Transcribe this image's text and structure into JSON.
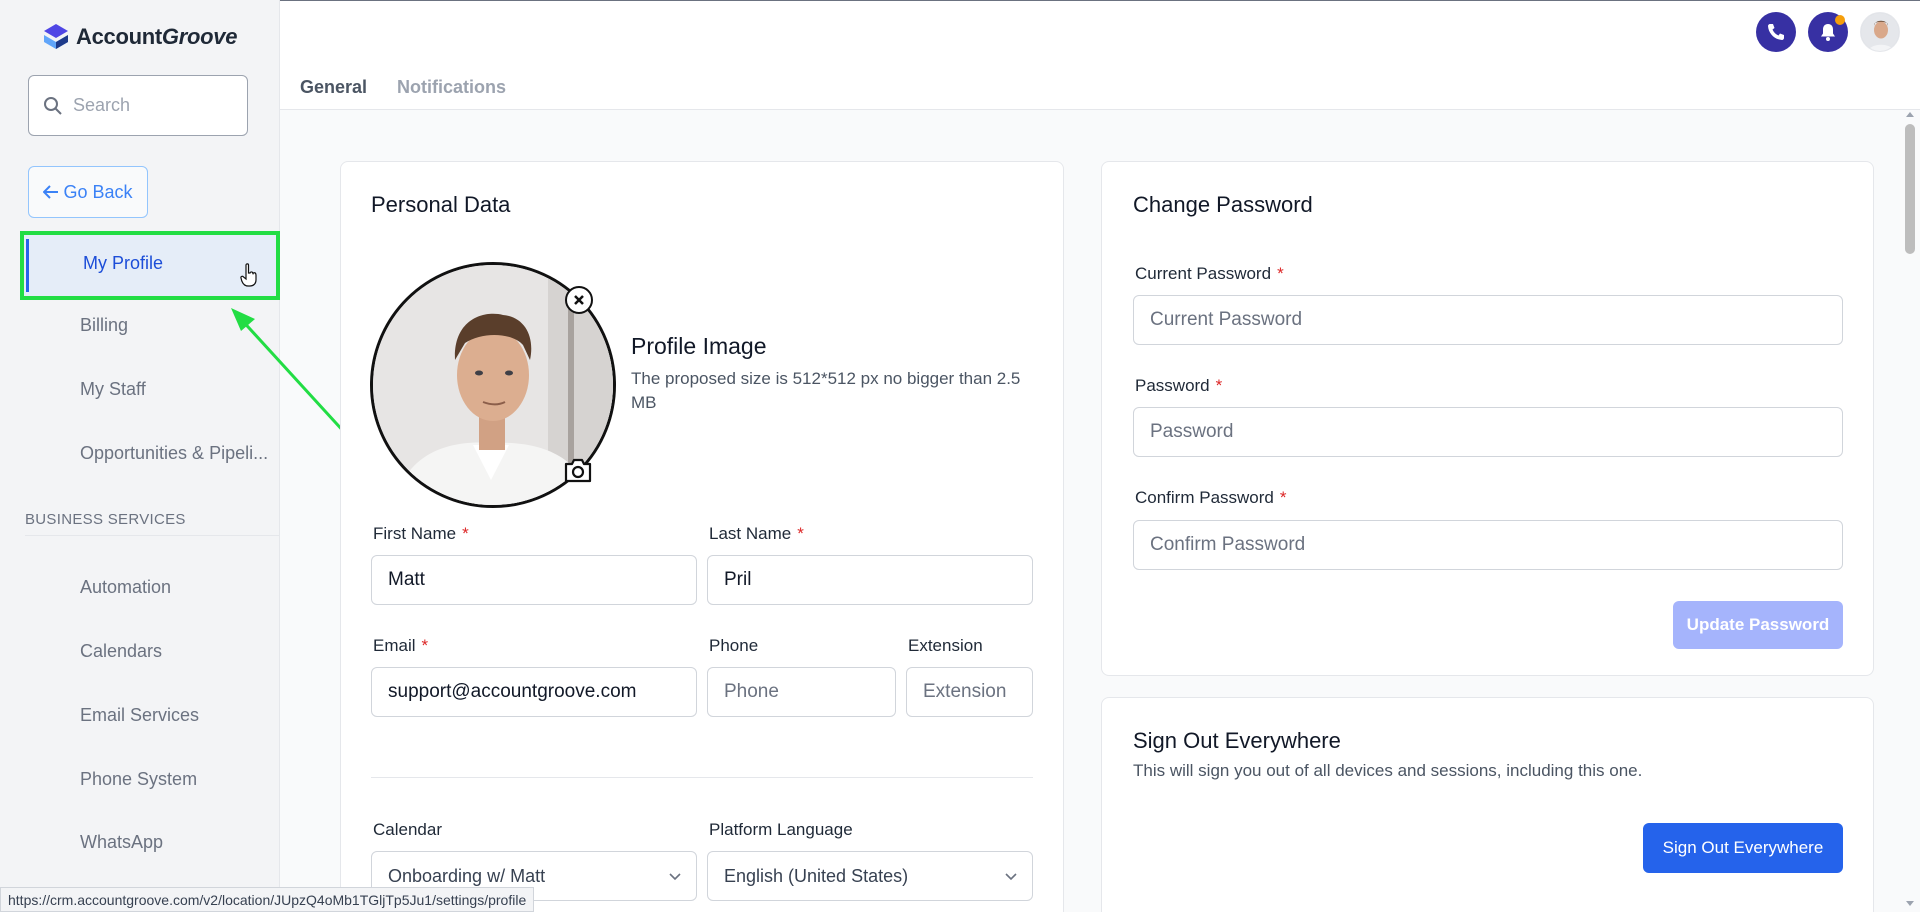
{
  "app": {
    "logo_text_main": "Account",
    "logo_text_accent": "Groove"
  },
  "sidebar": {
    "search_placeholder": "Search",
    "go_back_label": "Go Back",
    "items": [
      {
        "label": "My Profile",
        "active": true
      },
      {
        "label": "Billing"
      },
      {
        "label": "My Staff"
      },
      {
        "label": "Opportunities & Pipeli..."
      }
    ],
    "section_label": "BUSINESS SERVICES",
    "business_items": [
      {
        "label": "Automation"
      },
      {
        "label": "Calendars"
      },
      {
        "label": "Email Services"
      },
      {
        "label": "Phone System"
      },
      {
        "label": "WhatsApp"
      }
    ]
  },
  "tabs": [
    {
      "label": "General",
      "active": true
    },
    {
      "label": "Notifications"
    }
  ],
  "personal_data": {
    "title": "Personal Data",
    "profile_image_title": "Profile Image",
    "profile_image_hint": "The proposed size is 512*512 px no bigger than 2.5 MB",
    "first_name": {
      "label": "First Name",
      "value": "Matt",
      "required": true
    },
    "last_name": {
      "label": "Last Name",
      "value": "Pril",
      "required": true
    },
    "email": {
      "label": "Email",
      "value": "support@accountgroove.com",
      "required": true
    },
    "phone": {
      "label": "Phone",
      "placeholder": "Phone"
    },
    "extension": {
      "label": "Extension",
      "placeholder": "Extension"
    },
    "calendar": {
      "label": "Calendar",
      "value": "Onboarding w/ Matt"
    },
    "platform_language": {
      "label": "Platform Language",
      "value": "English (United States)"
    }
  },
  "change_password": {
    "title": "Change Password",
    "current_password": {
      "label": "Current Password",
      "placeholder": "Current Password",
      "required": true
    },
    "password": {
      "label": "Password",
      "placeholder": "Password",
      "required": true
    },
    "confirm_password": {
      "label": "Confirm Password",
      "placeholder": "Confirm Password",
      "required": true
    },
    "update_button": "Update Password"
  },
  "sign_out": {
    "title": "Sign Out Everywhere",
    "description": "This will sign you out of all devices and sessions, including this one.",
    "button": "Sign Out Everywhere"
  },
  "status_bar_url": "https://crm.accountgroove.com/v2/location/JUpzQ4oMb1TGljTp5Ju1/settings/profile",
  "colors": {
    "accent": "#2563eb",
    "highlight": "#22dd44",
    "required": "#dc2626",
    "topbar_buttons": "#3730a3",
    "notification_dot": "#f59e0b"
  },
  "icons": [
    "search-icon",
    "arrow-left-icon",
    "phone-icon",
    "bell-icon",
    "close-circle-icon",
    "camera-icon",
    "chevron-down-icon",
    "pointer-cursor-icon"
  ]
}
